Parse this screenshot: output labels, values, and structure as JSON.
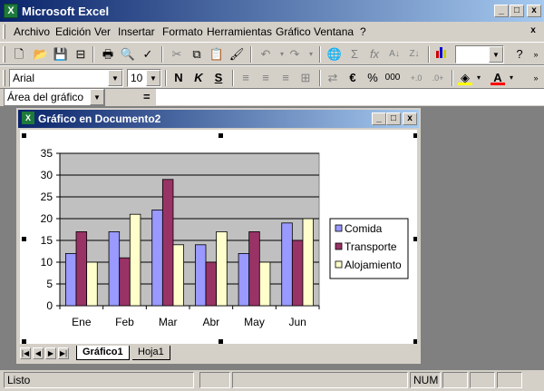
{
  "app": {
    "title": "Microsoft Excel",
    "icon": "excel-icon"
  },
  "window_controls": {
    "minimize": "_",
    "maximize": "□",
    "close": "x"
  },
  "menu": [
    "Archivo",
    "Edición",
    "Ver",
    "Insertar",
    "Formato",
    "Herramientas",
    "Gráfico",
    "Ventana",
    "?"
  ],
  "format_toolbar": {
    "font": "Arial",
    "size": "10",
    "bold": "N",
    "italic": "K",
    "underline": "S",
    "currency": "€",
    "percent": "%",
    "thousands": "000"
  },
  "formula_bar": {
    "name_box": "Área del gráfico",
    "equals": "="
  },
  "workbook": {
    "title": "Gráfico en Documento2"
  },
  "sheet_tabs": [
    "Gráfico1",
    "Hoja1"
  ],
  "active_tab": "Gráfico1",
  "status": {
    "text": "Listo",
    "num": "NUM"
  },
  "colors": {
    "comida": "#9999ff",
    "transporte": "#993366",
    "alojamiento": "#ffffcc",
    "plot_bg": "#c0c0c0"
  },
  "chart_data": {
    "type": "bar",
    "categories": [
      "Ene",
      "Feb",
      "Mar",
      "Abr",
      "May",
      "Jun"
    ],
    "series": [
      {
        "name": "Comida",
        "values": [
          12,
          17,
          22,
          14,
          12,
          19
        ]
      },
      {
        "name": "Transporte",
        "values": [
          17,
          11,
          29,
          10,
          17,
          15
        ]
      },
      {
        "name": "Alojamiento",
        "values": [
          10,
          21,
          14,
          17,
          10,
          20
        ]
      }
    ],
    "yticks": [
      0,
      5,
      10,
      15,
      20,
      25,
      30,
      35
    ],
    "ylim": [
      0,
      35
    ],
    "grid": true,
    "legend": "right"
  }
}
